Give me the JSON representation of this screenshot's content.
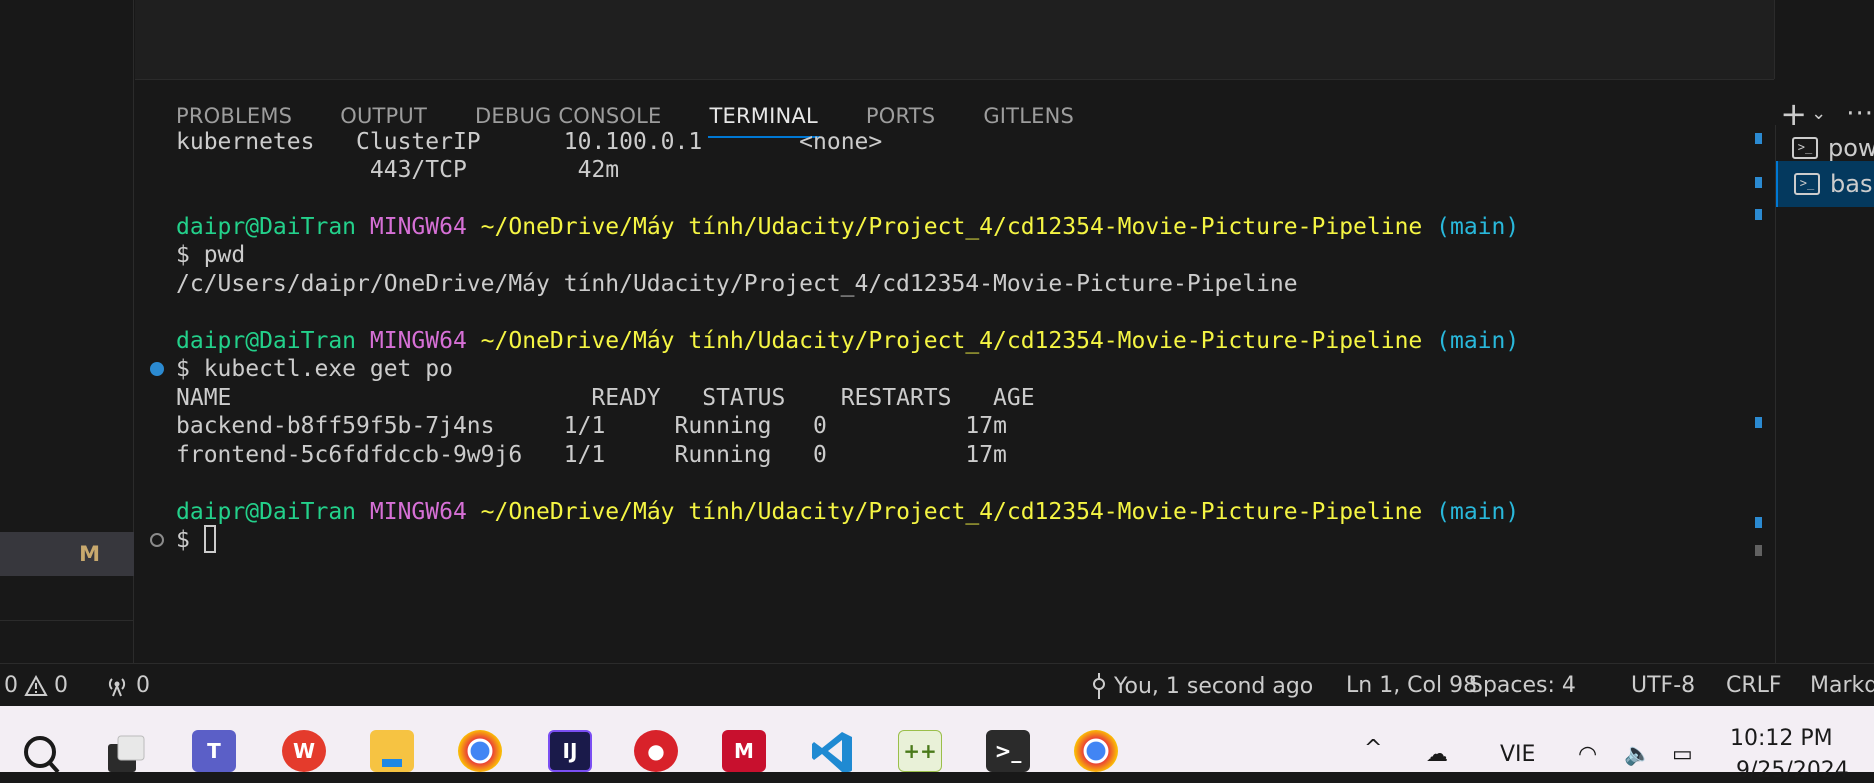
{
  "sidebar": {
    "git_status_letter": "M"
  },
  "panel": {
    "tabs": [
      "PROBLEMS",
      "OUTPUT",
      "DEBUG CONSOLE",
      "TERMINAL",
      "PORTS",
      "GITLENS"
    ],
    "active_tab": "TERMINAL",
    "actions": {
      "new_terminal": "+",
      "dropdown": "⌄",
      "more": "···"
    }
  },
  "terminal": {
    "svc_row": {
      "name": "kubernetes",
      "type": "ClusterIP",
      "cluster_ip": "10.100.0.1",
      "external_ip": "<none>"
    },
    "svc_row_wrap": {
      "ports": "443/TCP",
      "age": "42m"
    },
    "prompt": {
      "user": "daipr@DaiTran",
      "env": "MINGW64",
      "path": "~/OneDrive/Máy tính/Udacity/Project_4/cd12354-Movie-Picture-Pipeline",
      "branch": "(main)"
    },
    "cmd1": "$ pwd",
    "cmd1_output": "/c/Users/daipr/OneDrive/Máy tính/Udacity/Project_4/cd12354-Movie-Picture-Pipeline",
    "cmd2": "$ kubectl.exe get po",
    "pods_header": [
      "NAME",
      "READY",
      "STATUS",
      "RESTARTS",
      "AGE"
    ],
    "pods": [
      [
        "backend-b8ff59f5b-7j4ns",
        "1/1",
        "Running",
        "0",
        "17m"
      ],
      [
        "frontend-5c6fdfdccb-9w9j6",
        "1/1",
        "Running",
        "0",
        "17m"
      ]
    ],
    "current_prompt": "$"
  },
  "terminal_list": [
    {
      "label": "pow",
      "active": false
    },
    {
      "label": "bas",
      "active": true
    }
  ],
  "statusbar": {
    "errors": "0",
    "warnings": "0",
    "ports": "0",
    "blame": "You, 1 second ago",
    "cursor_pos": "Ln 1, Col 98",
    "indent": "Spaces: 4",
    "encoding": "UTF-8",
    "eol": "CRLF",
    "language": "Markd"
  },
  "taskbar": {
    "apps": [
      "search",
      "task-view",
      "teams",
      "wps-office",
      "file-explorer",
      "chrome-profile",
      "intellij",
      "app-red",
      "mcafee",
      "vscode",
      "notepad-plus-plus",
      "terminal",
      "chrome"
    ],
    "tray": {
      "language": "VIE"
    },
    "clock": {
      "time": "10:12 PM",
      "date": "9/25/2024"
    }
  }
}
